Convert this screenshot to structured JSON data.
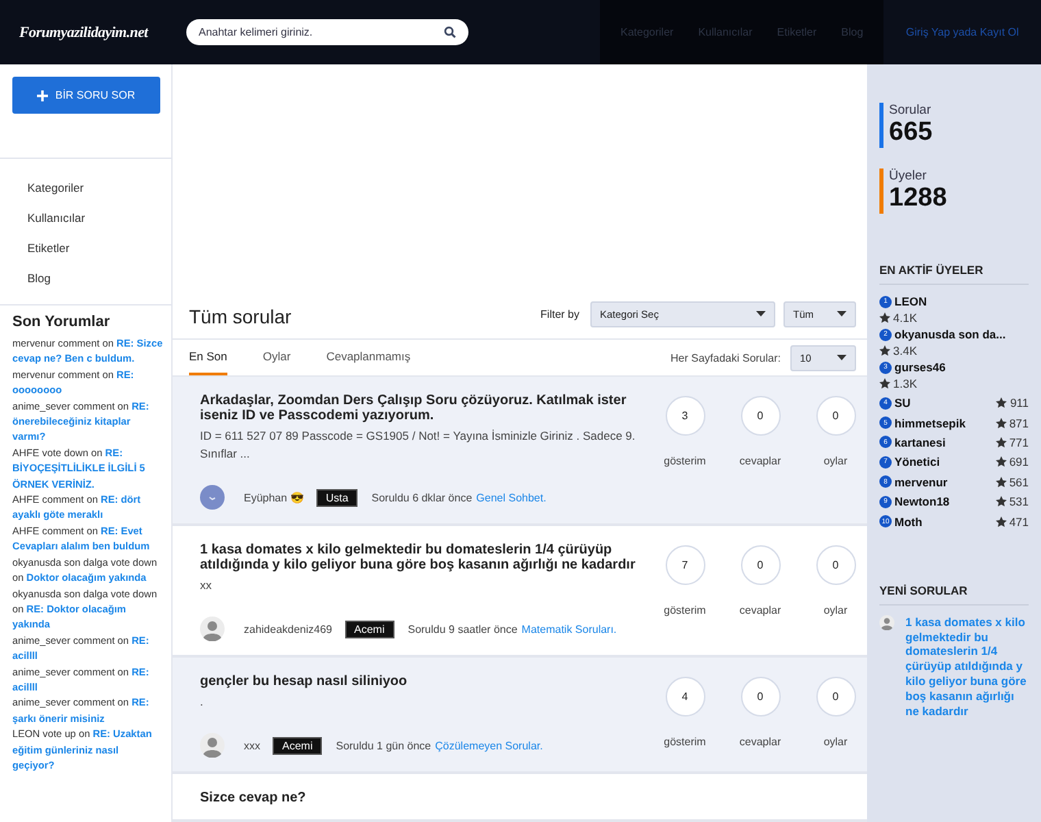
{
  "header": {
    "logo": "Forumyazilidayim.net",
    "search": {
      "placeholder": "Anahtar kelimeri giriniz."
    },
    "nav": [
      "Kategoriler",
      "Kullanıcılar",
      "Etiketler",
      "Blog"
    ],
    "login": "Giriş Yap yada Kayıt Ol"
  },
  "left": {
    "ask_button": "BİR SORU SOR",
    "nav": [
      "Kategoriler",
      "Kullanıcılar",
      "Etiketler",
      "Blog"
    ],
    "comments_title": "Son Yorumlar",
    "comments": [
      {
        "meta": "mervenur comment on",
        "link": "RE: Sizce cevap ne? Ben c buldum."
      },
      {
        "meta": "mervenur comment on",
        "link": "RE: oooooooo"
      },
      {
        "meta": "anime_sever comment on",
        "link": "RE: önerebileceğiniz kitaplar varmı?"
      },
      {
        "meta": "AHFE vote down on",
        "link": "RE: BİYOÇEŞİTLİLİKLE İLGİLİ 5 ÖRNEK VERİNİZ."
      },
      {
        "meta": "AHFE comment on",
        "link": "RE: dört ayaklı göte meraklı"
      },
      {
        "meta": "AHFE comment on",
        "link": "RE: Evet Cevapları alalım ben buldum"
      },
      {
        "meta": "okyanusda son dalga vote down on",
        "link": "Doktor olacağım yakında"
      },
      {
        "meta": "okyanusda son dalga vote down on",
        "link": "RE: Doktor olacağım yakında"
      },
      {
        "meta": "anime_sever comment on",
        "link": "RE: acillll"
      },
      {
        "meta": "anime_sever comment on",
        "link": "RE: acillll"
      },
      {
        "meta": "anime_sever comment on",
        "link": "RE: şarkı önerir misiniz"
      },
      {
        "meta": "LEON vote up on",
        "link": "RE: Uzaktan eğitim günleriniz nasıl geçiyor?"
      }
    ]
  },
  "main": {
    "title": "Tüm sorular",
    "filter_label": "Filter by",
    "category_select": "Kategori Seç",
    "scope_select": "Tüm",
    "tabs": [
      {
        "label": "En Son",
        "selected": true
      },
      {
        "label": "Oylar",
        "selected": false
      },
      {
        "label": "Cevaplanmamış",
        "selected": false
      }
    ],
    "per_page_label": "Her Sayfadaki Sorular:",
    "per_page": "10",
    "questions": [
      {
        "title": "Arkadaşlar, Zoomdan Ders Çalışıp Soru çözüyoruz. Katılmak ister iseniz ID ve Passcodemi yazıyorum.",
        "body": "ID = 611 527 07 89 Passcode = GS1905     / Not! = Yayına İsminizle Giriniz . Sadece 9. Sınıflar ...",
        "stats": [
          {
            "value": "3",
            "label": "gösterim"
          },
          {
            "value": "0",
            "label": "cevaplar"
          },
          {
            "value": "0",
            "label": "oylar"
          }
        ],
        "custom_avatar": true,
        "author": "Eyüphan 😎",
        "badge": "Usta",
        "asked": "Soruldu 6 dklar önce",
        "category": "Genel Sohbet."
      },
      {
        "title": "1 kasa domates x kilo gelmektedir bu domateslerin 1/4 çürüyüp atıldığında y kilo geliyor buna göre boş kasanın ağırlığı ne kadardır",
        "body": "xx",
        "stats": [
          {
            "value": "7",
            "label": "gösterim"
          },
          {
            "value": "0",
            "label": "cevaplar"
          },
          {
            "value": "0",
            "label": "oylar"
          }
        ],
        "custom_avatar": false,
        "author": "zahideakdeniz469",
        "badge": "Acemi",
        "asked": "Soruldu 9 saatler önce",
        "category": "Matematik Soruları."
      },
      {
        "title": "gençler bu hesap nasıl siliniyoo",
        "body": ".",
        "stats": [
          {
            "value": "4",
            "label": "gösterim"
          },
          {
            "value": "0",
            "label": "cevaplar"
          },
          {
            "value": "0",
            "label": "oylar"
          }
        ],
        "custom_avatar": false,
        "author": "xxx",
        "badge": "Acemi",
        "asked": "Soruldu 1 gün önce",
        "category": "Çözülemeyen Sorular."
      },
      {
        "title": "Sizce cevap ne?"
      }
    ]
  },
  "right": {
    "counts": [
      {
        "label": "Sorular",
        "value": "665",
        "color": "#1a73e8"
      },
      {
        "label": "Üyeler",
        "value": "1288",
        "color": "#f07c00"
      }
    ],
    "members_title": "EN AKTİF ÜYELER",
    "members": [
      {
        "rank": "1",
        "name": "LEON",
        "points": "4.1K"
      },
      {
        "rank": "2",
        "name": "okyanusda son da...",
        "points": "3.4K"
      },
      {
        "rank": "3",
        "name": "gurses46",
        "points": "1.3K"
      },
      {
        "rank": "4",
        "name": "SU",
        "points": "911"
      },
      {
        "rank": "5",
        "name": "himmetsepik",
        "points": "871"
      },
      {
        "rank": "6",
        "name": "kartanesi",
        "points": "771"
      },
      {
        "rank": "7",
        "name": "Yönetici",
        "points": "691"
      },
      {
        "rank": "8",
        "name": "mervenur",
        "points": "561"
      },
      {
        "rank": "9",
        "name": "Newton18",
        "points": "531"
      },
      {
        "rank": "10",
        "name": "Moth",
        "points": "471"
      }
    ],
    "new_title": "YENİ SORULAR",
    "new_questions": [
      "1 kasa domates x kilo gelmektedir bu domateslerin 1/4 çürüyüp atıldığında y kilo geliyor buna göre boş kasanın ağırlığı ne kadardır"
    ]
  }
}
